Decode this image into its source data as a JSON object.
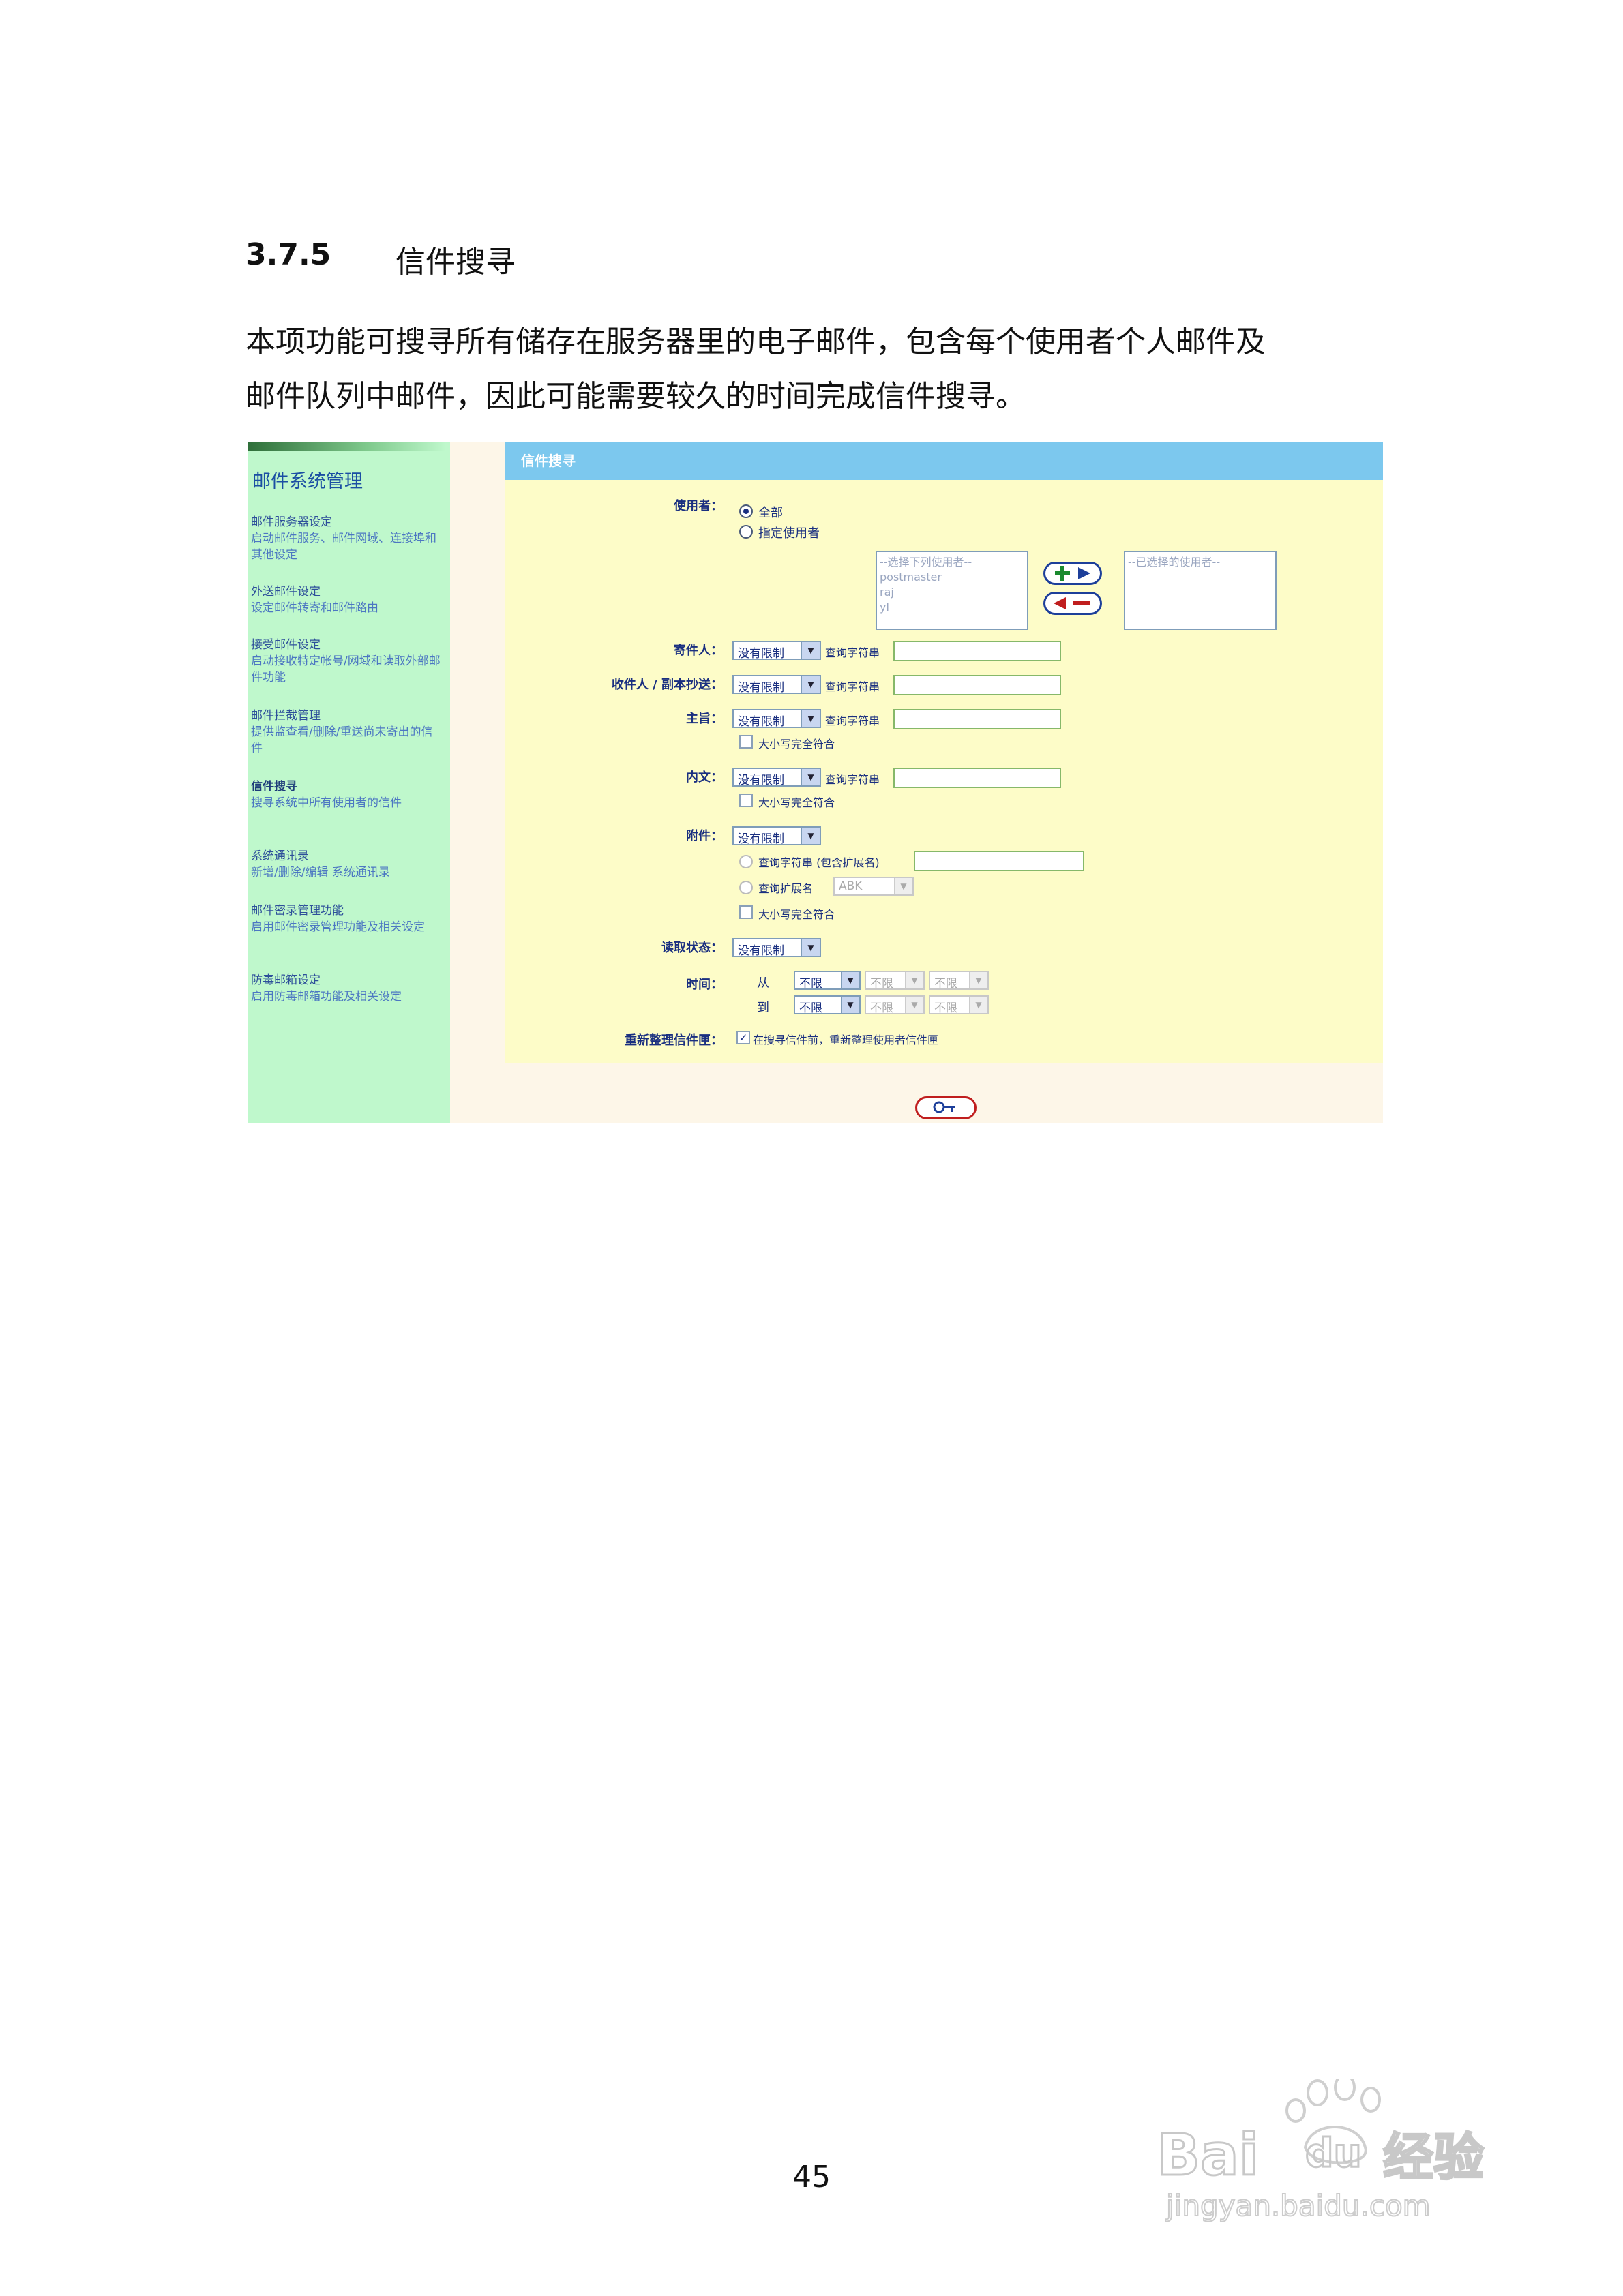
{
  "heading": {
    "number": "3.7.5",
    "title": "信件搜寻"
  },
  "paragraph": [
    "本项功能可搜寻所有储存在服务器里的电子邮件，包含每个使用者个人邮件及",
    "邮件队列中邮件，因此可能需要较久的时间完成信件搜寻。"
  ],
  "sidebar": {
    "title": "邮件系统管理",
    "items": [
      {
        "title": "邮件服务器设定",
        "desc": "启动邮件服务、邮件网域、连接埠和其他设定"
      },
      {
        "title": "外送邮件设定",
        "desc": "设定邮件转寄和邮件路由"
      },
      {
        "title": "接受邮件设定",
        "desc": "启动接收特定帐号/网域和读取外部邮件功能"
      },
      {
        "title": "邮件拦截管理",
        "desc": "提供监查看/删除/重送尚未寄出的信件"
      },
      {
        "title": "信件搜寻",
        "desc": "搜寻系统中所有使用者的信件"
      },
      {
        "title": "系统通讯录",
        "desc": "新增/删除/编辑 系统通讯录"
      },
      {
        "title": "邮件密录管理功能",
        "desc": "启用邮件密录管理功能及相关设定"
      },
      {
        "title": "防毒邮箱设定",
        "desc": "启用防毒邮箱功能及相关设定"
      }
    ]
  },
  "panel": {
    "header": "信件搜寻",
    "user_label": "使用者：",
    "user_all": "全部",
    "user_specified": "指定使用者",
    "available_users": [
      "--选择下列使用者--",
      "postmaster",
      "raj",
      "yl"
    ],
    "selected_users": [
      "--已选择的使用者--"
    ],
    "sender_label": "寄件人：",
    "recipient_label": "收件人 / 副本抄送：",
    "subject_label": "主旨：",
    "body_label": "内文：",
    "attachment_label": "附件：",
    "read_status_label": "读取状态：",
    "time_label": "时间：",
    "rearrange_label": "重新整理信件匣：",
    "no_limit": "没有限制",
    "query_string": "查询字符串",
    "case_match": "大小写完全符合",
    "att_query_string": "查询字符串 (包含扩展名)",
    "att_ext": "查询扩展名",
    "att_ext_value": "ABK",
    "from_label": "从",
    "to_label": "到",
    "unlimited": "不限",
    "rearrange_text": "在搜寻信件前，重新整理使用者信件匣"
  },
  "page_number": "45",
  "watermark": {
    "brand": "Bai du 经验",
    "url": "jingyan.baidu.com"
  }
}
